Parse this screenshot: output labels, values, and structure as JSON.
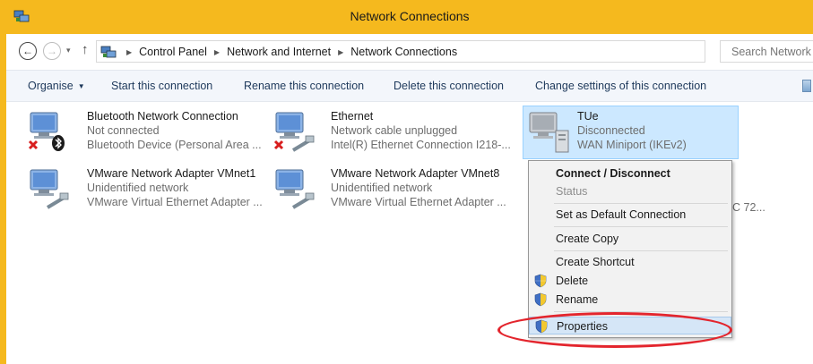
{
  "window": {
    "title": "Network Connections"
  },
  "address": {
    "crumbs": [
      "Control Panel",
      "Network and Internet",
      "Network Connections"
    ],
    "search_placeholder": "Search Network Connections"
  },
  "commands": {
    "organise": "Organise",
    "start": "Start this connection",
    "rename": "Rename this connection",
    "delete": "Delete this connection",
    "change": "Change settings of this connection"
  },
  "connections": [
    {
      "name": "Bluetooth Network Connection",
      "status": "Not connected",
      "device": "Bluetooth Device (Personal Area ..."
    },
    {
      "name": "Ethernet",
      "status": "Network cable unplugged",
      "device": "Intel(R) Ethernet Connection I218-..."
    },
    {
      "name": "TUe",
      "status": "Disconnected",
      "device": "WAN Miniport (IKEv2)"
    },
    {
      "name": "VMware Network Adapter VMnet1",
      "status": "Unidentified network",
      "device": "VMware Virtual Ethernet Adapter ..."
    },
    {
      "name": "VMware Network Adapter VMnet8",
      "status": "Unidentified network",
      "device": "VMware Virtual Ethernet Adapter ..."
    }
  ],
  "hidden_fragment": "C 72...",
  "context_menu": {
    "connect": "Connect / Disconnect",
    "status": "Status",
    "set_default": "Set as Default Connection",
    "create_copy": "Create Copy",
    "create_shortcut": "Create Shortcut",
    "delete": "Delete",
    "rename": "Rename",
    "properties": "Properties"
  },
  "colors": {
    "titlebar": "#f5b91e",
    "selection": "#cce8ff",
    "annotation": "#e3252d"
  }
}
